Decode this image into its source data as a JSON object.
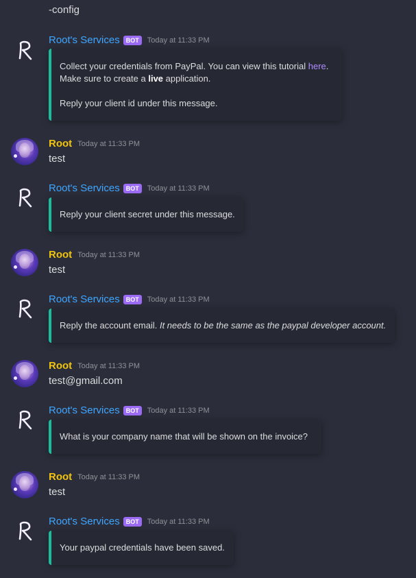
{
  "top_text": "-config",
  "bot_name": "Root's Services",
  "bot_tag": "BOT",
  "user_name": "Root",
  "timestamp": "Today at 11:33 PM",
  "msg1": {
    "line1_pre": "Collect your credentials from PayPal. You can view this tutorial ",
    "line1_link": "here",
    "line1_post": ".",
    "line2_pre": "Make sure to create a ",
    "line2_bold": "live",
    "line2_post": " application.",
    "line3": "Reply your client id under this message."
  },
  "reply1": "test",
  "msg2": "Reply your client secret under this message.",
  "reply2": "test",
  "msg3_pre": "Reply the account email. ",
  "msg3_italic": "It needs to be the same as the paypal developer account.",
  "reply3": "test@gmail.com",
  "msg4": "What is your company name that will be shown on the invoice?",
  "reply4": "test",
  "msg5": "Your paypal credentials have been saved."
}
